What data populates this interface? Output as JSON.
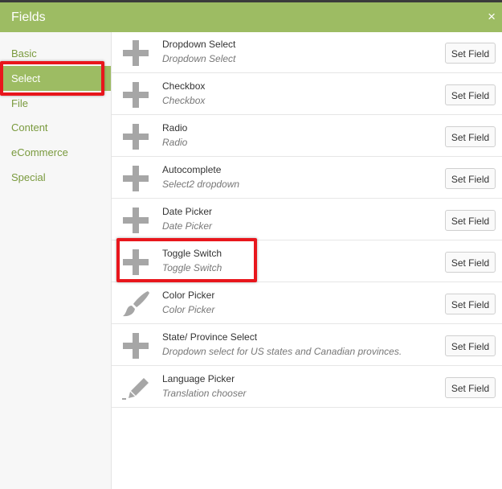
{
  "dialog": {
    "title": "Fields",
    "close_label": "×"
  },
  "colors": {
    "accent": "#9dbc63",
    "link": "#7a9a3e",
    "highlight": "#e8161c",
    "icon": "#a6a6a6"
  },
  "sidebar": {
    "items": [
      {
        "label": "Basic"
      },
      {
        "label": "Select",
        "active": true
      },
      {
        "label": "File"
      },
      {
        "label": "Content"
      },
      {
        "label": "eCommerce"
      },
      {
        "label": "Special"
      }
    ]
  },
  "fields": [
    {
      "name": "Dropdown Select",
      "desc": "Dropdown Select",
      "icon": "plus-icon",
      "button": "Set Field"
    },
    {
      "name": "Checkbox",
      "desc": "Checkbox",
      "icon": "plus-icon",
      "button": "Set Field"
    },
    {
      "name": "Radio",
      "desc": "Radio",
      "icon": "plus-icon",
      "button": "Set Field"
    },
    {
      "name": "Autocomplete",
      "desc": "Select2 dropdown",
      "icon": "plus-icon",
      "button": "Set Field"
    },
    {
      "name": "Date Picker",
      "desc": "Date Picker",
      "icon": "plus-icon",
      "button": "Set Field"
    },
    {
      "name": "Toggle Switch",
      "desc": "Toggle Switch",
      "icon": "plus-icon",
      "button": "Set Field"
    },
    {
      "name": "Color Picker",
      "desc": "Color Picker",
      "icon": "paintbrush-icon",
      "button": "Set Field"
    },
    {
      "name": "State/ Province Select",
      "desc": "Dropdown select for US states and Canadian provinces.",
      "icon": "plus-icon",
      "button": "Set Field"
    },
    {
      "name": "Language Picker",
      "desc": "Translation chooser",
      "icon": "pencil-icon",
      "button": "Set Field"
    }
  ]
}
